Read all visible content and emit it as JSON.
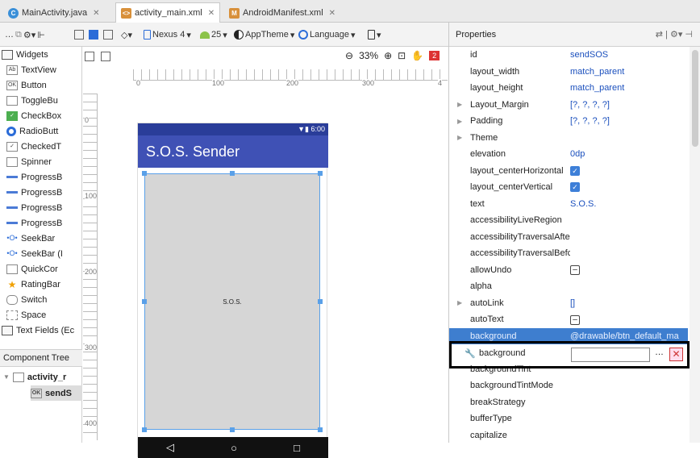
{
  "tabs": [
    {
      "label": "MainActivity.java",
      "icon": "java-class-icon"
    },
    {
      "label": "activity_main.xml",
      "icon": "layout-xml-icon"
    },
    {
      "label": "AndroidManifest.xml",
      "icon": "manifest-xml-icon"
    }
  ],
  "toolbar": {
    "device": "Nexus 4",
    "api": "25",
    "theme": "AppTheme",
    "language": "Language",
    "zoom": "33%",
    "badge": "2"
  },
  "ruler": {
    "h": [
      "0",
      "100",
      "200",
      "300",
      "4"
    ],
    "v": [
      "0",
      "100",
      "200",
      "300",
      "400"
    ]
  },
  "palette": {
    "category": "Widgets",
    "items": [
      {
        "label": "TextView",
        "icon": "Ab"
      },
      {
        "label": "Button",
        "icon": "OK"
      },
      {
        "label": "ToggleBu",
        "icon": ""
      },
      {
        "label": "CheckBox",
        "icon": "✓"
      },
      {
        "label": "RadioButt",
        "icon": ""
      },
      {
        "label": "CheckedT",
        "icon": "✓"
      },
      {
        "label": "Spinner",
        "icon": ""
      },
      {
        "label": "ProgressB",
        "icon": ""
      },
      {
        "label": "ProgressB",
        "icon": ""
      },
      {
        "label": "ProgressB",
        "icon": ""
      },
      {
        "label": "ProgressB",
        "icon": ""
      },
      {
        "label": "SeekBar",
        "icon": ""
      },
      {
        "label": "SeekBar (I",
        "icon": ""
      },
      {
        "label": "QuickCor",
        "icon": ""
      },
      {
        "label": "RatingBar",
        "icon": ""
      },
      {
        "label": "Switch",
        "icon": ""
      },
      {
        "label": "Space",
        "icon": ""
      }
    ],
    "category2": "Text Fields (Ec"
  },
  "component_tree": {
    "title": "Component Tree",
    "root": "activity_r",
    "child": "sendS"
  },
  "phone": {
    "status": "6:00",
    "app_title": "S.O.S. Sender",
    "button_text": "S.O.S."
  },
  "properties": {
    "title": "Properties",
    "rows": [
      {
        "name": "id",
        "value": "sendSOS"
      },
      {
        "name": "layout_width",
        "value": "match_parent"
      },
      {
        "name": "layout_height",
        "value": "match_parent"
      },
      {
        "name": "Layout_Margin",
        "value": "[?, ?, ?, ?]",
        "expand": true
      },
      {
        "name": "Padding",
        "value": "[?, ?, ?, ?]",
        "expand": true
      },
      {
        "name": "Theme",
        "value": "",
        "expand": true
      },
      {
        "name": "elevation",
        "value": "0dp"
      },
      {
        "name": "layout_centerHorizontal",
        "value": "",
        "check": true
      },
      {
        "name": "layout_centerVertical",
        "value": "",
        "check": true
      },
      {
        "name": "text",
        "value": "S.O.S."
      },
      {
        "name": "accessibilityLiveRegion",
        "value": ""
      },
      {
        "name": "accessibilityTraversalAfte",
        "value": ""
      },
      {
        "name": "accessibilityTraversalBefc",
        "value": ""
      },
      {
        "name": "allowUndo",
        "value": "",
        "minus": true
      },
      {
        "name": "alpha",
        "value": ""
      },
      {
        "name": "autoLink",
        "value": "[]",
        "expand": true
      },
      {
        "name": "autoText",
        "value": "",
        "minus": true
      },
      {
        "name": "background",
        "value": "@drawable/btn_default_ma",
        "selected": true
      },
      {
        "name": "background",
        "value": "",
        "editor": true
      },
      {
        "name": "backgroundTint",
        "value": ""
      },
      {
        "name": "backgroundTintMode",
        "value": ""
      },
      {
        "name": "breakStrategy",
        "value": ""
      },
      {
        "name": "bufferType",
        "value": ""
      },
      {
        "name": "capitalize",
        "value": ""
      }
    ]
  },
  "colors": {
    "accent": "#3f51b5",
    "status": "#2a3d99",
    "selected": "#3e7ecf"
  }
}
